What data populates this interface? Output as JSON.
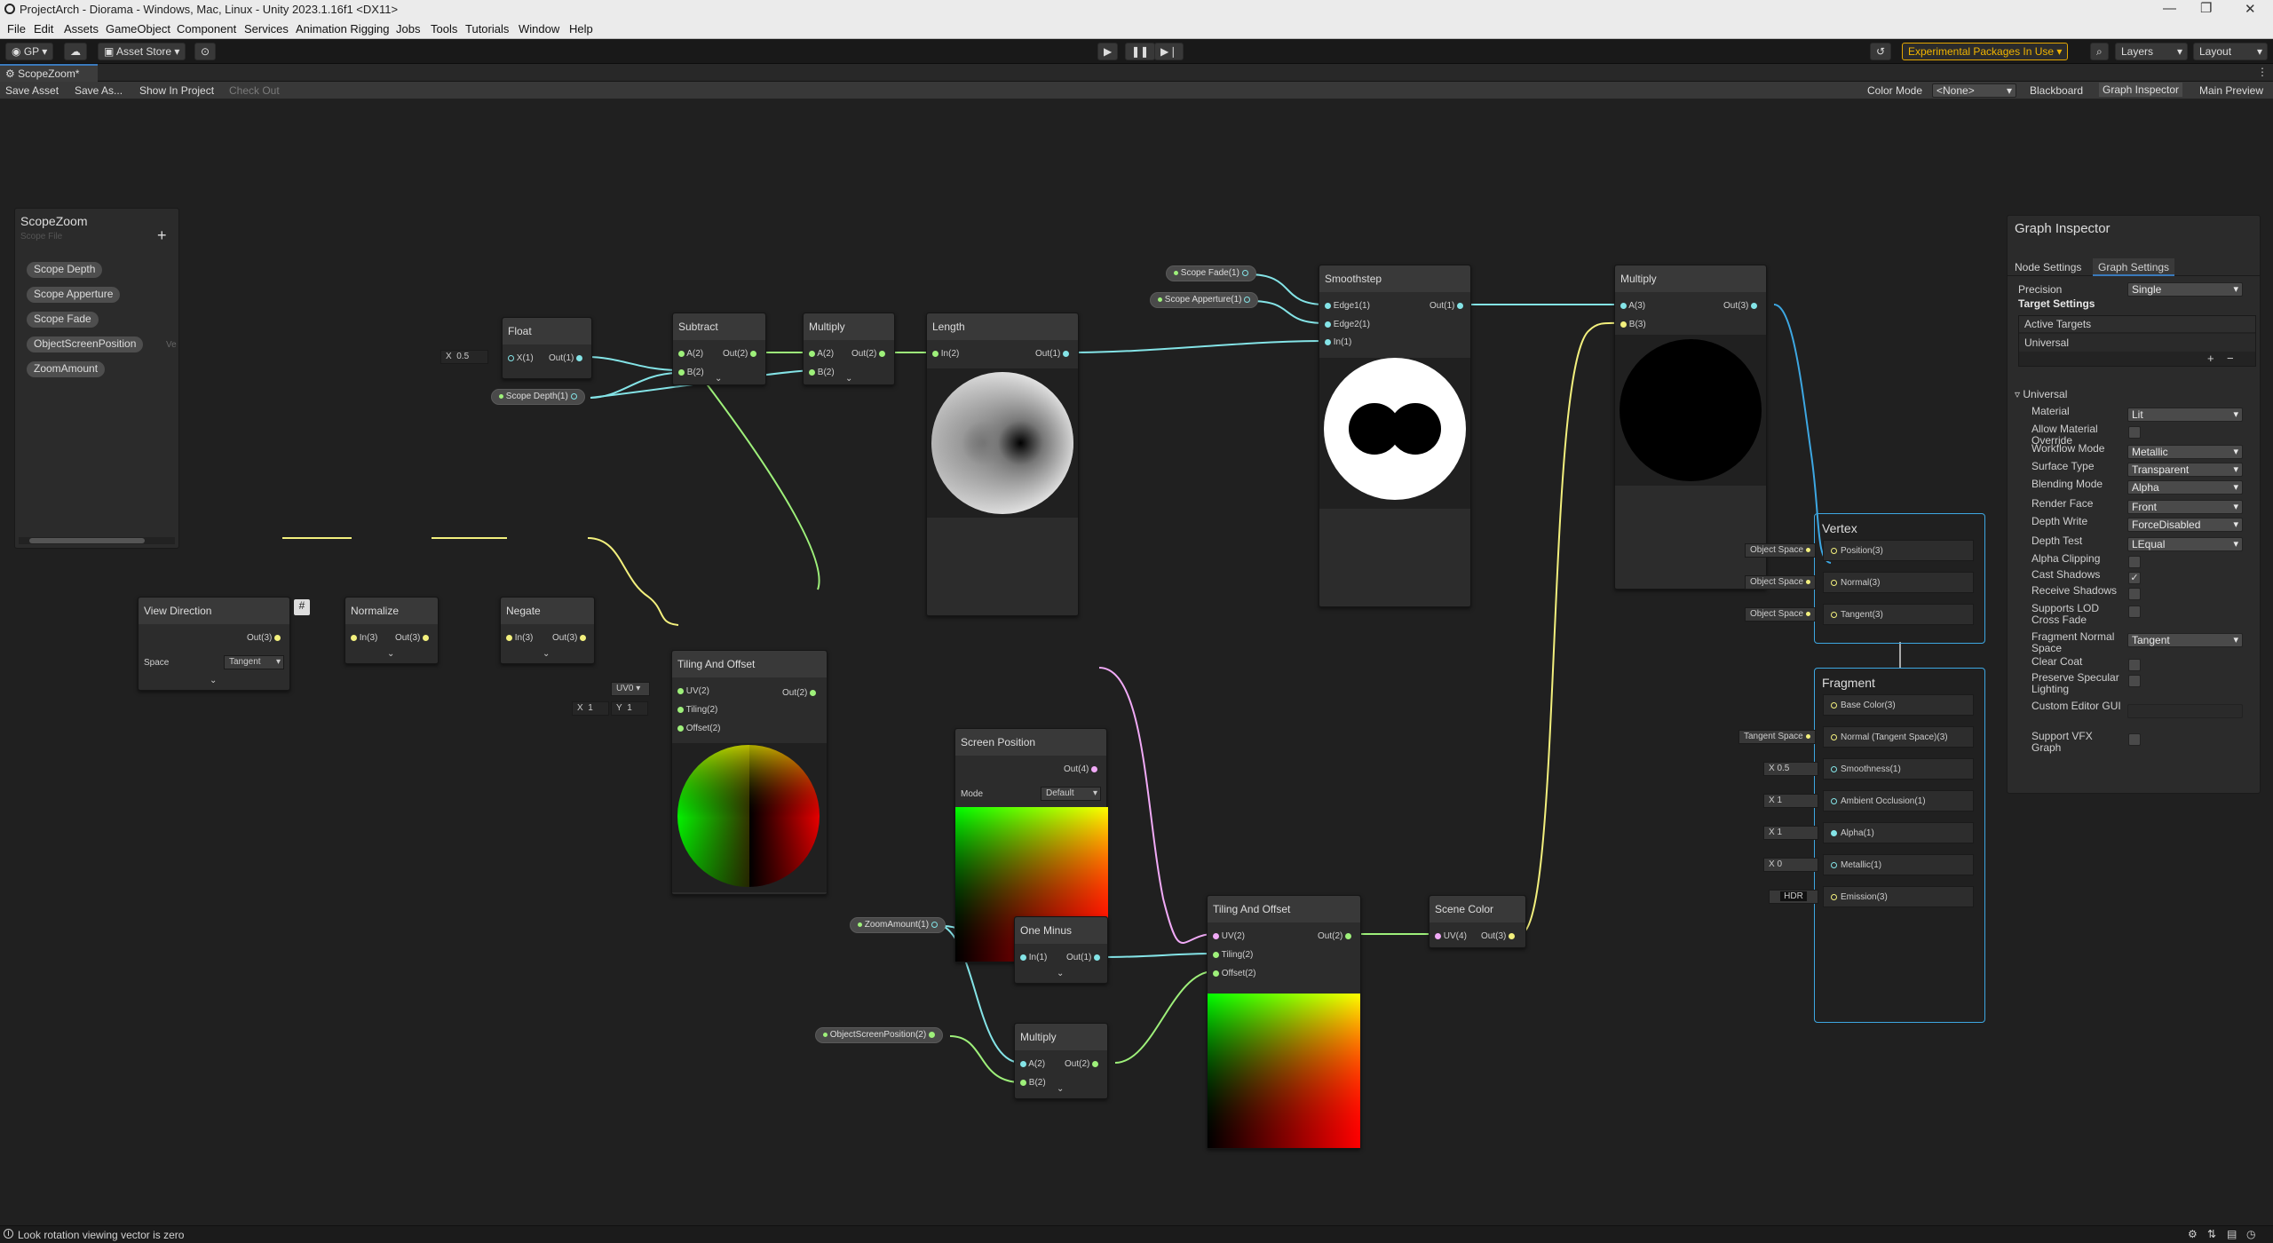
{
  "window": {
    "title": "ProjectArch - Diorama - Windows, Mac, Linux - Unity 2023.1.16f1 <DX11>"
  },
  "menu": [
    "File",
    "Edit",
    "Assets",
    "GameObject",
    "Component",
    "Services",
    "Animation Rigging",
    "Jobs",
    "Tools",
    "Tutorials",
    "Window",
    "Help"
  ],
  "toolbar": {
    "account": "GP",
    "asset_store": "Asset Store",
    "experimental": "Experimental Packages In Use",
    "layers": "Layers",
    "layout": "Layout"
  },
  "tab": {
    "title": "ScopeZoom*"
  },
  "graph_toolbar": {
    "save_asset": "Save Asset",
    "save_as": "Save As...",
    "show_in_project": "Show In Project",
    "check_out": "Check Out",
    "color_mode_label": "Color Mode",
    "color_mode_value": "<None>",
    "blackboard": "Blackboard",
    "graph_inspector": "Graph Inspector",
    "main_preview": "Main Preview"
  },
  "blackboard": {
    "title": "ScopeZoom",
    "subtitle": "Scope File",
    "properties": [
      "Scope Depth",
      "Scope Apperture",
      "Scope Fade",
      "ObjectScreenPosition",
      "ZoomAmount"
    ],
    "trailing": "Ve"
  },
  "nodes": {
    "float": {
      "title": "Float",
      "in": "X(1)",
      "out": "Out(1)",
      "x_label": "X",
      "x_value": "0.5"
    },
    "scope_depth_prop": {
      "label": "Scope Depth(1)"
    },
    "subtract": {
      "title": "Subtract",
      "a": "A(2)",
      "b": "B(2)",
      "out": "Out(2)"
    },
    "multiply1": {
      "title": "Multiply",
      "a": "A(2)",
      "b": "B(2)",
      "out": "Out(2)"
    },
    "length": {
      "title": "Length",
      "in": "In(2)",
      "out": "Out(1)"
    },
    "scope_fade_prop": {
      "label": "Scope Fade(1)"
    },
    "scope_apperture_prop": {
      "label": "Scope Apperture(1)"
    },
    "smoothstep": {
      "title": "Smoothstep",
      "edge1": "Edge1(1)",
      "edge2": "Edge2(1)",
      "in": "In(1)",
      "out": "Out(1)"
    },
    "multiply2": {
      "title": "Multiply",
      "a": "A(3)",
      "b": "B(3)",
      "out": "Out(3)"
    },
    "view_direction": {
      "title": "View Direction",
      "out": "Out(3)",
      "space_label": "Space",
      "space_value": "Tangent"
    },
    "normalize": {
      "title": "Normalize",
      "in": "In(3)",
      "out": "Out(3)"
    },
    "negate": {
      "title": "Negate",
      "in": "In(3)",
      "out": "Out(3)"
    },
    "tiling_offset1": {
      "title": "Tiling And Offset",
      "uv": "UV(2)",
      "tiling": "Tiling(2)",
      "offset": "Offset(2)",
      "out": "Out(2)",
      "uv_input": "UV0",
      "x_label": "X",
      "x_value": "1",
      "y_label": "Y",
      "y_value": "1"
    },
    "screen_position": {
      "title": "Screen Position",
      "out": "Out(4)",
      "mode_label": "Mode",
      "mode_value": "Default"
    },
    "zoom_prop": {
      "label": "ZoomAmount(1)"
    },
    "one_minus": {
      "title": "One Minus",
      "in": "In(1)",
      "out": "Out(1)"
    },
    "osp_prop": {
      "label": "ObjectScreenPosition(2)"
    },
    "multiply3": {
      "title": "Multiply",
      "a": "A(2)",
      "b": "B(2)",
      "out": "Out(2)"
    },
    "tiling_offset2": {
      "title": "Tiling And Offset",
      "uv": "UV(2)",
      "tiling": "Tiling(2)",
      "offset": "Offset(2)",
      "out": "Out(2)"
    },
    "scene_color": {
      "title": "Scene Color",
      "uv": "UV(4)",
      "out": "Out(3)"
    }
  },
  "vertex": {
    "title": "Vertex",
    "slots": [
      {
        "label": "Object Space",
        "name": "Position(3)"
      },
      {
        "label": "Object Space",
        "name": "Normal(3)"
      },
      {
        "label": "Object Space",
        "name": "Tangent(3)"
      }
    ]
  },
  "fragment": {
    "title": "Fragment",
    "slots": [
      {
        "label": "",
        "name": "Base Color(3)"
      },
      {
        "label": "Tangent Space",
        "name": "Normal (Tangent Space)(3)"
      },
      {
        "label": "X  0.5",
        "name": "Smoothness(1)"
      },
      {
        "label": "X  1",
        "name": "Ambient Occlusion(1)"
      },
      {
        "label": "X  1",
        "name": "Alpha(1)"
      },
      {
        "label": "X  0",
        "name": "Metallic(1)"
      },
      {
        "label": "HDR",
        "name": "Emission(3)"
      }
    ]
  },
  "inspector": {
    "title": "Graph Inspector",
    "tabs": [
      "Node Settings",
      "Graph Settings"
    ],
    "precision_label": "Precision",
    "precision_value": "Single",
    "target_settings": "Target Settings",
    "active_targets": "Active Targets",
    "target": "Universal",
    "section": "Universal",
    "rows": [
      {
        "label": "Material",
        "type": "dropdown",
        "value": "Lit"
      },
      {
        "label": "Allow Material Override",
        "type": "checkbox",
        "value": ""
      },
      {
        "label": "Workflow Mode",
        "type": "dropdown",
        "value": "Metallic"
      },
      {
        "label": "Surface Type",
        "type": "dropdown",
        "value": "Transparent"
      },
      {
        "label": "Blending Mode",
        "type": "dropdown",
        "value": "Alpha"
      },
      {
        "label": "Render Face",
        "type": "dropdown",
        "value": "Front"
      },
      {
        "label": "Depth Write",
        "type": "dropdown",
        "value": "ForceDisabled"
      },
      {
        "label": "Depth Test",
        "type": "dropdown",
        "value": "LEqual"
      },
      {
        "label": "Alpha Clipping",
        "type": "checkbox",
        "value": ""
      },
      {
        "label": "Cast Shadows",
        "type": "checkbox",
        "value": "✓"
      },
      {
        "label": "Receive Shadows",
        "type": "checkbox",
        "value": ""
      },
      {
        "label": "Supports LOD Cross Fade",
        "type": "checkbox",
        "value": ""
      },
      {
        "label": "Fragment Normal Space",
        "type": "dropdown",
        "value": "Tangent"
      },
      {
        "label": "Clear Coat",
        "type": "checkbox",
        "value": ""
      },
      {
        "label": "Preserve Specular Lighting",
        "type": "checkbox",
        "value": ""
      },
      {
        "label": "Custom Editor GUI",
        "type": "field",
        "value": ""
      },
      {
        "label": "Support VFX Graph",
        "type": "checkbox",
        "value": ""
      }
    ]
  },
  "status": {
    "message": "Look rotation viewing vector is zero"
  },
  "colors": {
    "vec1": "#84e4e7",
    "vec2": "#9ef07a",
    "vec3": "#f3f07d",
    "vec4": "#f1aaf7",
    "context_border": "#3da7e2",
    "experimental": "#f0b400"
  }
}
